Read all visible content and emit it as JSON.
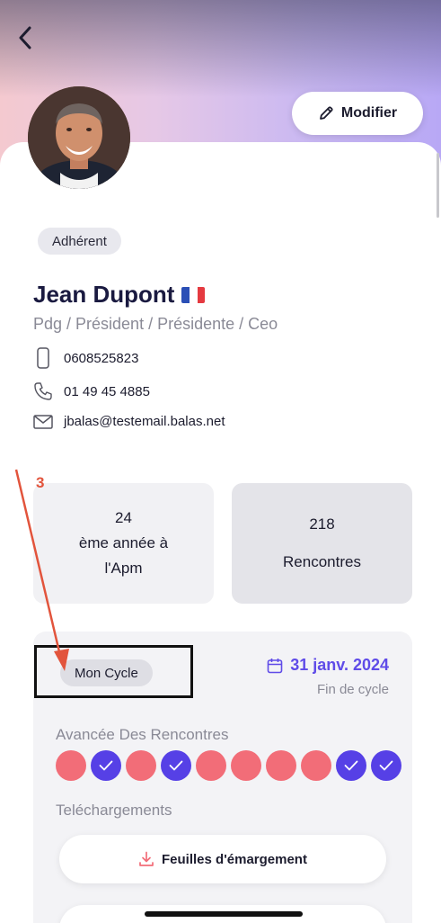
{
  "header": {
    "back_icon": "chevron-left-icon"
  },
  "profile": {
    "edit_label": "Modifier",
    "edit_icon": "pencil-icon",
    "badge": "Adhérent",
    "name": "Jean Dupont",
    "flag_icon": "france-flag-icon",
    "role": "Pdg / Président / Présidente / Ceo",
    "contacts": {
      "mobile": "0608525823",
      "phone": "01 49 45 4885",
      "email": "jbalas@testemail.balas.net"
    }
  },
  "stats": [
    {
      "value": "24",
      "label_line1": "ème année à",
      "label_line2": "l'Apm"
    },
    {
      "value": "218",
      "label": "Rencontres"
    }
  ],
  "cycle": {
    "chip_label": "Mon Cycle",
    "date": "31 janv. 2024",
    "end_label": "Fin de cycle",
    "progress_title": "Avancée Des Rencontres",
    "progress": [
      "pending",
      "done",
      "pending",
      "done",
      "pending",
      "pending",
      "pending",
      "pending",
      "done",
      "done"
    ],
    "downloads_title": "Teléchargements",
    "downloads": [
      {
        "label": "Feuilles d'émargement",
        "icon": "download-icon"
      }
    ]
  },
  "annotation": {
    "number": "3"
  },
  "colors": {
    "accent": "#5f4be8",
    "done_dot": "#5640e6",
    "pending_dot": "#f26d78",
    "annotation": "#e2543c"
  }
}
